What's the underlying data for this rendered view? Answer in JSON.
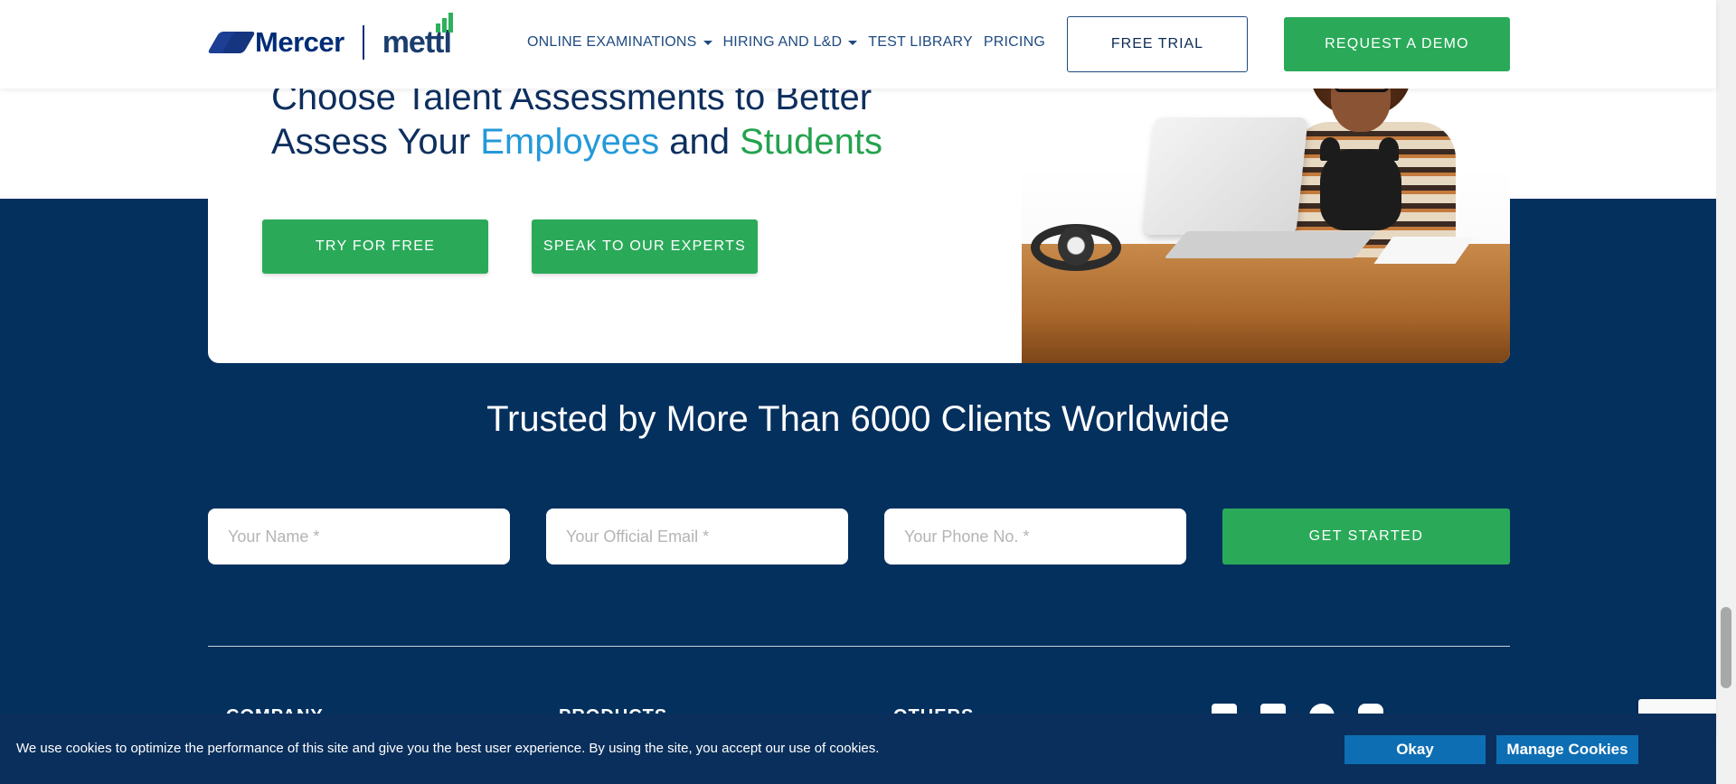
{
  "header": {
    "logo_mercer": "Mercer",
    "logo_mettl": "mettl",
    "nav": [
      {
        "label": "ONLINE EXAMINATIONS",
        "dropdown": true
      },
      {
        "label": "HIRING AND L&D",
        "dropdown": true
      },
      {
        "label": "TEST LIBRARY",
        "dropdown": false
      },
      {
        "label": "PRICING",
        "dropdown": false
      }
    ],
    "free_trial": "FREE TRIAL",
    "request_demo": "REQUEST A DEMO"
  },
  "hero": {
    "title_line1": "Choose Talent Assessments to Better",
    "title_line2_prefix": "Assess Your ",
    "title_highlight_1": "Employees",
    "title_and": " and ",
    "title_highlight_2": "Students",
    "try_free": "TRY FOR FREE",
    "speak_experts": "SPEAK TO OUR EXPERTS"
  },
  "trusted": {
    "heading": "Trusted by More Than 6000 Clients Worldwide"
  },
  "form": {
    "name_placeholder": "Your Name *",
    "email_placeholder": "Your Official Email *",
    "phone_placeholder": "Your Phone No. *",
    "submit": "GET STARTED"
  },
  "footer": {
    "headings": [
      "COMPANY",
      "PRODUCTS",
      "OTHERS"
    ],
    "social_icons": [
      "facebook-icon",
      "linkedin-icon",
      "twitter-icon",
      "youtube-icon"
    ]
  },
  "cookie": {
    "text": "We use cookies to optimize the performance of this site and give you the best user experience. By using the site, you accept our use of cookies.",
    "okay": "Okay",
    "manage": "Manage Cookies"
  },
  "colors": {
    "navy": "#04305e",
    "green": "#2aaa59",
    "blue_highlight": "#2499d9",
    "green_highlight": "#25a24e",
    "cookie_button": "#0e6eb3"
  }
}
